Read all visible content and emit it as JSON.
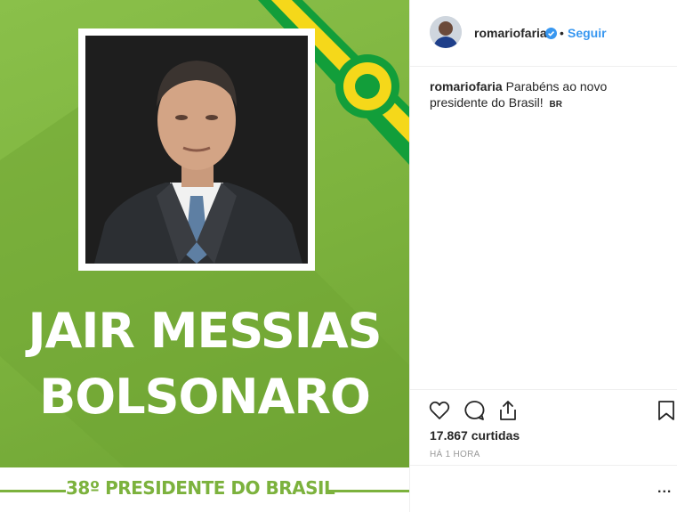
{
  "post": {
    "headline_line1": "JAIR MESSIAS",
    "headline_line2": "BOLSONARO",
    "subtitle": "38º PRESIDENTE DO BRASIL"
  },
  "header": {
    "username": "romariofaria",
    "separator": "•",
    "follow_label": "Seguir"
  },
  "caption": {
    "username": "romariofaria",
    "text": "Parabéns ao novo presidente do Brasil!",
    "flag": "BR"
  },
  "stats": {
    "likes": "17.867 curtidas",
    "time": "HÁ 1 HORA"
  },
  "comment": {
    "more_label": "..."
  },
  "colors": {
    "brand_green": "#7cb23d",
    "flag_yellow": "#f5d81a",
    "flag_green": "#129e3a",
    "link_blue": "#3897f0"
  },
  "icons": [
    "heart-icon",
    "comment-icon",
    "share-icon",
    "bookmark-icon",
    "verified-icon"
  ]
}
